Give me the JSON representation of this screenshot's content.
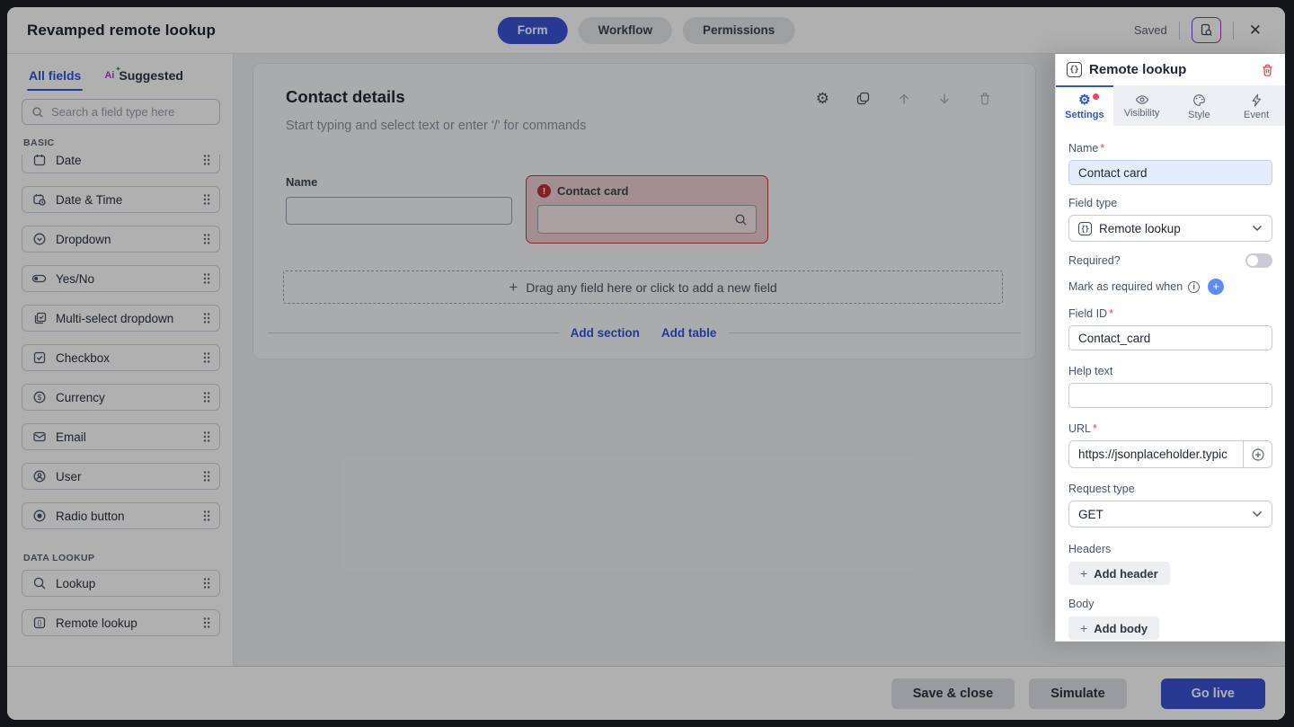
{
  "topbar": {
    "title": "Revamped remote lookup",
    "view_tabs": [
      {
        "label": "Form"
      },
      {
        "label": "Workflow"
      },
      {
        "label": "Permissions"
      }
    ],
    "saved_status": "Saved"
  },
  "sidebar": {
    "tabs": [
      {
        "label": "All fields"
      },
      {
        "label": "Suggested"
      }
    ],
    "ai_glyph": "Ai",
    "search_placeholder": "Search a field type here",
    "sections": [
      {
        "label": "BASIC",
        "items": [
          {
            "label": "Date",
            "icon": "calendar-icon"
          },
          {
            "label": "Date & Time",
            "icon": "calendar-clock-icon"
          },
          {
            "label": "Dropdown",
            "icon": "chevron-circle-icon"
          },
          {
            "label": "Yes/No",
            "icon": "toggle-icon"
          },
          {
            "label": "Multi-select dropdown",
            "icon": "multi-select-icon"
          },
          {
            "label": "Checkbox",
            "icon": "checkbox-icon"
          },
          {
            "label": "Currency",
            "icon": "currency-icon"
          },
          {
            "label": "Email",
            "icon": "envelope-icon"
          },
          {
            "label": "User",
            "icon": "user-icon"
          },
          {
            "label": "Radio button",
            "icon": "radio-icon"
          }
        ]
      },
      {
        "label": "DATA LOOKUP",
        "items": [
          {
            "label": "Lookup",
            "icon": "search-icon"
          },
          {
            "label": "Remote lookup",
            "icon": "braces-icon"
          }
        ]
      }
    ]
  },
  "canvas": {
    "section_title": "Contact details",
    "typing_placeholder": "Start typing and select text or enter '/' for commands",
    "name_field": {
      "label": "Name",
      "value": ""
    },
    "error_field": {
      "label": "Contact card",
      "value": ""
    },
    "dropzone_label": "Drag any field here or click to add a new field",
    "add_section_label": "Add section",
    "add_table_label": "Add table"
  },
  "panel": {
    "title": "Remote lookup",
    "tabs": [
      {
        "label": "Settings"
      },
      {
        "label": "Visibility"
      },
      {
        "label": "Style"
      },
      {
        "label": "Event"
      }
    ],
    "name": {
      "label": "Name",
      "value": "Contact card"
    },
    "field_type": {
      "label": "Field type",
      "value": "Remote lookup"
    },
    "required_toggle": {
      "label": "Required?",
      "on": false
    },
    "mark_required": {
      "label": "Mark as required when"
    },
    "field_id": {
      "label": "Field ID",
      "value": "Contact_card"
    },
    "help_text": {
      "label": "Help text",
      "value": ""
    },
    "url": {
      "label": "URL",
      "value": "https://jsonplaceholder.typic"
    },
    "request_type": {
      "label": "Request type",
      "value": "GET"
    },
    "headers": {
      "label": "Headers",
      "button": "Add header"
    },
    "body": {
      "label": "Body",
      "button": "Add body"
    }
  },
  "footer": {
    "buttons": [
      {
        "label": "Save & close"
      },
      {
        "label": "Simulate"
      },
      {
        "label": "Go live"
      }
    ]
  },
  "colors": {
    "brand_blue": "#3a53d6",
    "panel_blue": "#2f55d4",
    "danger_red": "#e5484d",
    "error_bg": "#eccfd2",
    "error_border": "#c43a41"
  }
}
